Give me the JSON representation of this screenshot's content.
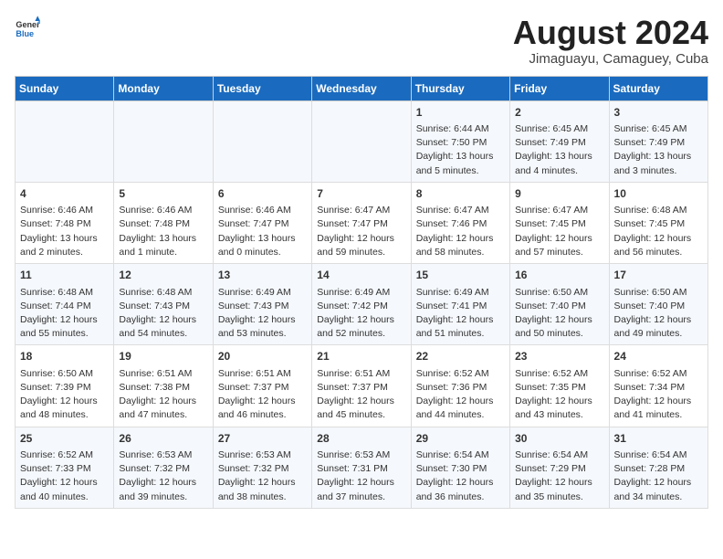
{
  "header": {
    "logo_general": "General",
    "logo_blue": "Blue",
    "month_title": "August 2024",
    "subtitle": "Jimaguayu, Camaguey, Cuba"
  },
  "weekdays": [
    "Sunday",
    "Monday",
    "Tuesday",
    "Wednesday",
    "Thursday",
    "Friday",
    "Saturday"
  ],
  "weeks": [
    [
      {
        "day": "",
        "content": ""
      },
      {
        "day": "",
        "content": ""
      },
      {
        "day": "",
        "content": ""
      },
      {
        "day": "",
        "content": ""
      },
      {
        "day": "1",
        "content": "Sunrise: 6:44 AM\nSunset: 7:50 PM\nDaylight: 13 hours\nand 5 minutes."
      },
      {
        "day": "2",
        "content": "Sunrise: 6:45 AM\nSunset: 7:49 PM\nDaylight: 13 hours\nand 4 minutes."
      },
      {
        "day": "3",
        "content": "Sunrise: 6:45 AM\nSunset: 7:49 PM\nDaylight: 13 hours\nand 3 minutes."
      }
    ],
    [
      {
        "day": "4",
        "content": "Sunrise: 6:46 AM\nSunset: 7:48 PM\nDaylight: 13 hours\nand 2 minutes."
      },
      {
        "day": "5",
        "content": "Sunrise: 6:46 AM\nSunset: 7:48 PM\nDaylight: 13 hours\nand 1 minute."
      },
      {
        "day": "6",
        "content": "Sunrise: 6:46 AM\nSunset: 7:47 PM\nDaylight: 13 hours\nand 0 minutes."
      },
      {
        "day": "7",
        "content": "Sunrise: 6:47 AM\nSunset: 7:47 PM\nDaylight: 12 hours\nand 59 minutes."
      },
      {
        "day": "8",
        "content": "Sunrise: 6:47 AM\nSunset: 7:46 PM\nDaylight: 12 hours\nand 58 minutes."
      },
      {
        "day": "9",
        "content": "Sunrise: 6:47 AM\nSunset: 7:45 PM\nDaylight: 12 hours\nand 57 minutes."
      },
      {
        "day": "10",
        "content": "Sunrise: 6:48 AM\nSunset: 7:45 PM\nDaylight: 12 hours\nand 56 minutes."
      }
    ],
    [
      {
        "day": "11",
        "content": "Sunrise: 6:48 AM\nSunset: 7:44 PM\nDaylight: 12 hours\nand 55 minutes."
      },
      {
        "day": "12",
        "content": "Sunrise: 6:48 AM\nSunset: 7:43 PM\nDaylight: 12 hours\nand 54 minutes."
      },
      {
        "day": "13",
        "content": "Sunrise: 6:49 AM\nSunset: 7:43 PM\nDaylight: 12 hours\nand 53 minutes."
      },
      {
        "day": "14",
        "content": "Sunrise: 6:49 AM\nSunset: 7:42 PM\nDaylight: 12 hours\nand 52 minutes."
      },
      {
        "day": "15",
        "content": "Sunrise: 6:49 AM\nSunset: 7:41 PM\nDaylight: 12 hours\nand 51 minutes."
      },
      {
        "day": "16",
        "content": "Sunrise: 6:50 AM\nSunset: 7:40 PM\nDaylight: 12 hours\nand 50 minutes."
      },
      {
        "day": "17",
        "content": "Sunrise: 6:50 AM\nSunset: 7:40 PM\nDaylight: 12 hours\nand 49 minutes."
      }
    ],
    [
      {
        "day": "18",
        "content": "Sunrise: 6:50 AM\nSunset: 7:39 PM\nDaylight: 12 hours\nand 48 minutes."
      },
      {
        "day": "19",
        "content": "Sunrise: 6:51 AM\nSunset: 7:38 PM\nDaylight: 12 hours\nand 47 minutes."
      },
      {
        "day": "20",
        "content": "Sunrise: 6:51 AM\nSunset: 7:37 PM\nDaylight: 12 hours\nand 46 minutes."
      },
      {
        "day": "21",
        "content": "Sunrise: 6:51 AM\nSunset: 7:37 PM\nDaylight: 12 hours\nand 45 minutes."
      },
      {
        "day": "22",
        "content": "Sunrise: 6:52 AM\nSunset: 7:36 PM\nDaylight: 12 hours\nand 44 minutes."
      },
      {
        "day": "23",
        "content": "Sunrise: 6:52 AM\nSunset: 7:35 PM\nDaylight: 12 hours\nand 43 minutes."
      },
      {
        "day": "24",
        "content": "Sunrise: 6:52 AM\nSunset: 7:34 PM\nDaylight: 12 hours\nand 41 minutes."
      }
    ],
    [
      {
        "day": "25",
        "content": "Sunrise: 6:52 AM\nSunset: 7:33 PM\nDaylight: 12 hours\nand 40 minutes."
      },
      {
        "day": "26",
        "content": "Sunrise: 6:53 AM\nSunset: 7:32 PM\nDaylight: 12 hours\nand 39 minutes."
      },
      {
        "day": "27",
        "content": "Sunrise: 6:53 AM\nSunset: 7:32 PM\nDaylight: 12 hours\nand 38 minutes."
      },
      {
        "day": "28",
        "content": "Sunrise: 6:53 AM\nSunset: 7:31 PM\nDaylight: 12 hours\nand 37 minutes."
      },
      {
        "day": "29",
        "content": "Sunrise: 6:54 AM\nSunset: 7:30 PM\nDaylight: 12 hours\nand 36 minutes."
      },
      {
        "day": "30",
        "content": "Sunrise: 6:54 AM\nSunset: 7:29 PM\nDaylight: 12 hours\nand 35 minutes."
      },
      {
        "day": "31",
        "content": "Sunrise: 6:54 AM\nSunset: 7:28 PM\nDaylight: 12 hours\nand 34 minutes."
      }
    ]
  ]
}
